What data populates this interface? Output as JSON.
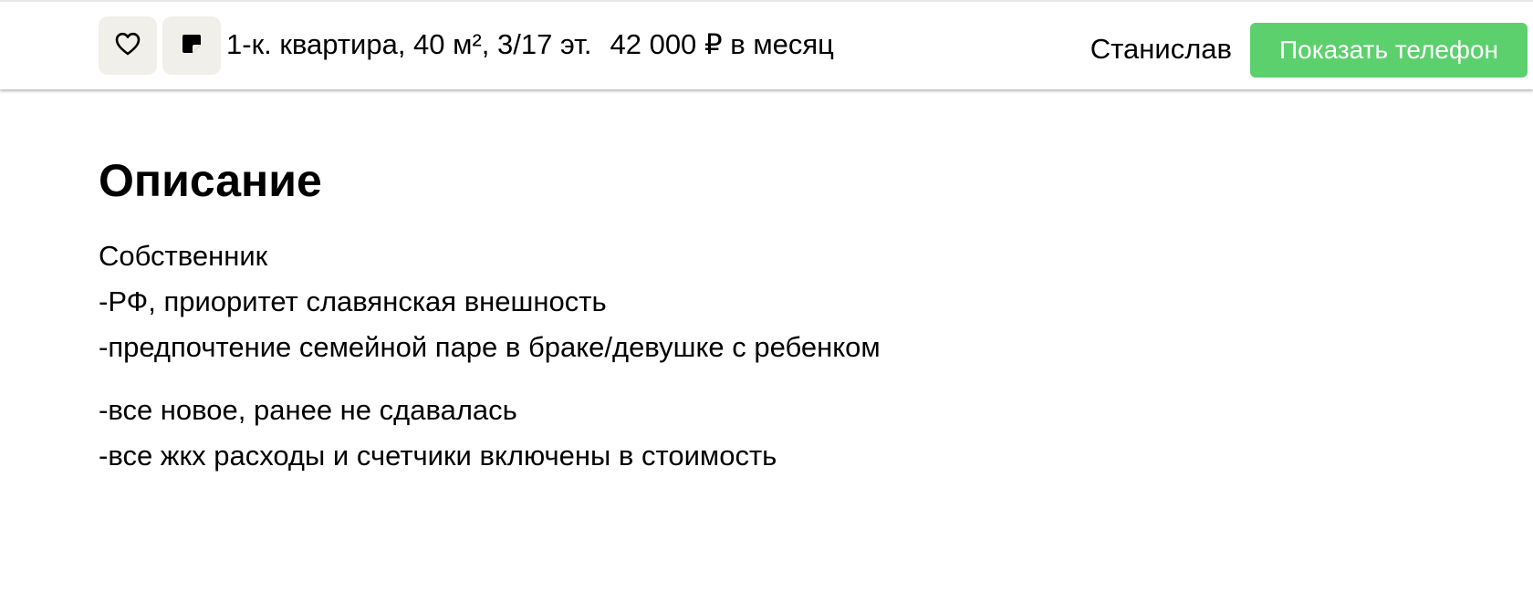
{
  "header": {
    "favorite_icon": "heart-icon",
    "note_icon": "note-icon",
    "title": "1-к. квартира, 40 м², 3/17 эт.",
    "price": "42 000 ₽ в месяц",
    "seller_name": "Станислав",
    "show_phone_label": "Показать телефон",
    "show_phone_color": "#5dd06e"
  },
  "description": {
    "heading": "Описание",
    "lines": [
      "Собственник",
      "-РФ, приоритет славянская внешность",
      "-предпочтение семейной паре в браке/девушке с ребенком",
      "-все новое, ранее не сдавалась",
      "-все жкх расходы и счетчики включены в стоимость"
    ]
  }
}
